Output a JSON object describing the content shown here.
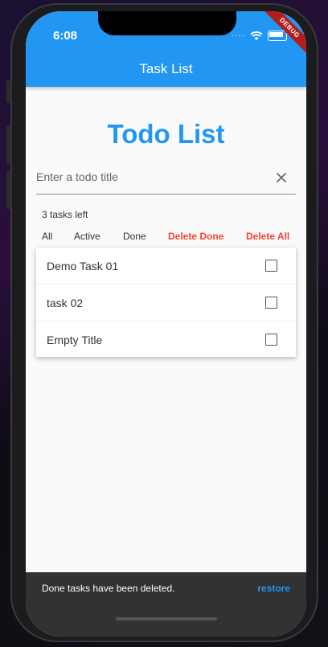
{
  "status_bar": {
    "time": "6:08",
    "debug_label": "DEBUG"
  },
  "appbar": {
    "title": "Task List"
  },
  "page": {
    "title": "Todo List"
  },
  "input": {
    "placeholder": "Enter a todo title",
    "value": ""
  },
  "summary": {
    "tasks_left": "3 tasks left"
  },
  "filters": {
    "all": "All",
    "active": "Active",
    "done": "Done",
    "delete_done": "Delete Done",
    "delete_all": "Delete All"
  },
  "tasks": [
    {
      "title": "Demo Task 01",
      "done": false
    },
    {
      "title": "task 02",
      "done": false
    },
    {
      "title": "Empty Title",
      "done": false
    }
  ],
  "snackbar": {
    "message": "Done tasks have been deleted.",
    "action": "restore"
  },
  "colors": {
    "primary": "#2196f3",
    "danger": "#f44336",
    "snackbar": "#323232",
    "debug": "#b71c1c"
  }
}
